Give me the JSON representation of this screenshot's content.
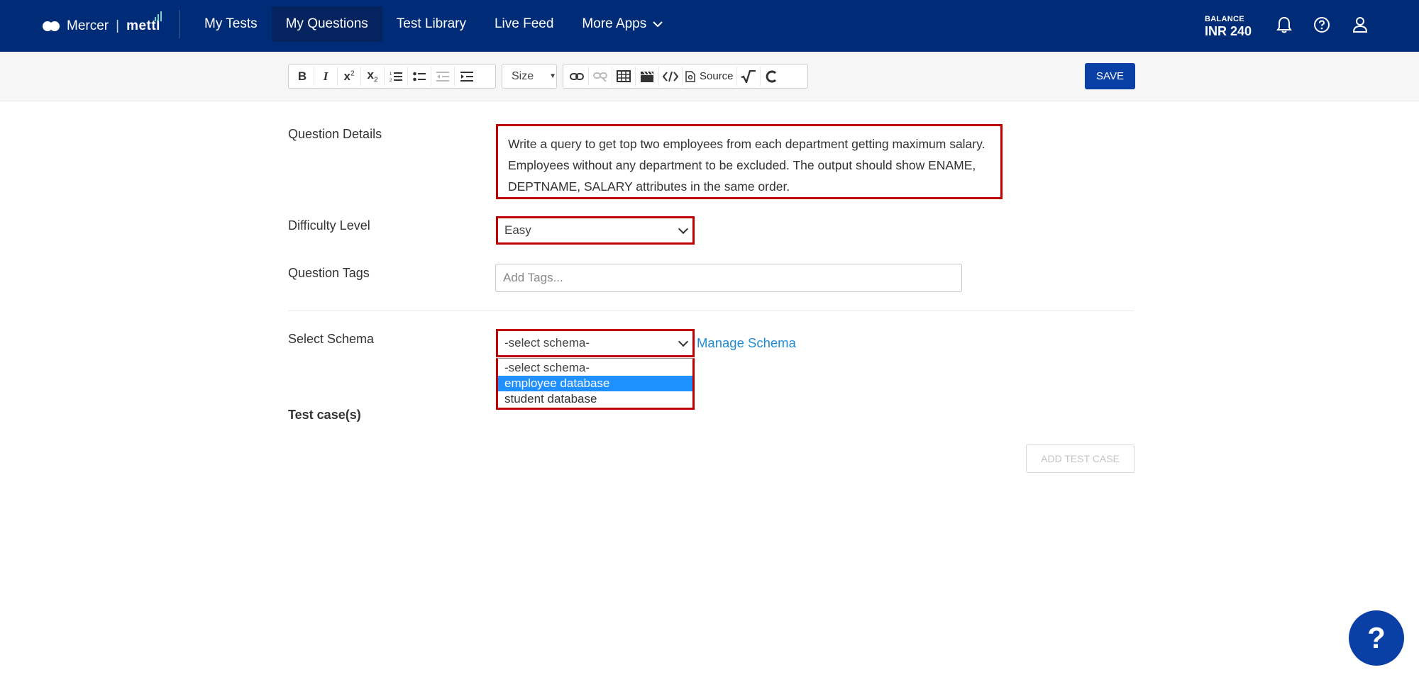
{
  "brand": {
    "name": "Mercer",
    "separator": "|",
    "product": "mettl"
  },
  "nav": {
    "items": [
      {
        "label": "My Tests"
      },
      {
        "label": "My Questions"
      },
      {
        "label": "Test Library"
      },
      {
        "label": "Live Feed"
      },
      {
        "label": "More Apps"
      }
    ],
    "active": "My Questions"
  },
  "balance": {
    "label": "BALANCE",
    "value": "INR 240"
  },
  "toolbar": {
    "size_label": "Size",
    "source_label": "Source",
    "save_label": "SAVE"
  },
  "form": {
    "question_details": {
      "label": "Question Details",
      "text": "Write a query to get top two employees from each department getting maximum salary. Employees without any department to be excluded. The output should show ENAME, DEPTNAME, SALARY attributes in the same order."
    },
    "difficulty": {
      "label": "Difficulty Level",
      "value": "Easy"
    },
    "tags": {
      "label": "Question Tags",
      "placeholder": "Add Tags..."
    },
    "schema": {
      "label": "Select Schema",
      "value": "-select schema-",
      "manage_label": "Manage Schema",
      "options": [
        "-select schema-",
        "employee database",
        "student database"
      ],
      "highlighted": "employee database"
    },
    "test_cases": {
      "label": "Test case(s)",
      "add_label": "ADD TEST CASE"
    }
  },
  "help": {
    "label": "?"
  }
}
